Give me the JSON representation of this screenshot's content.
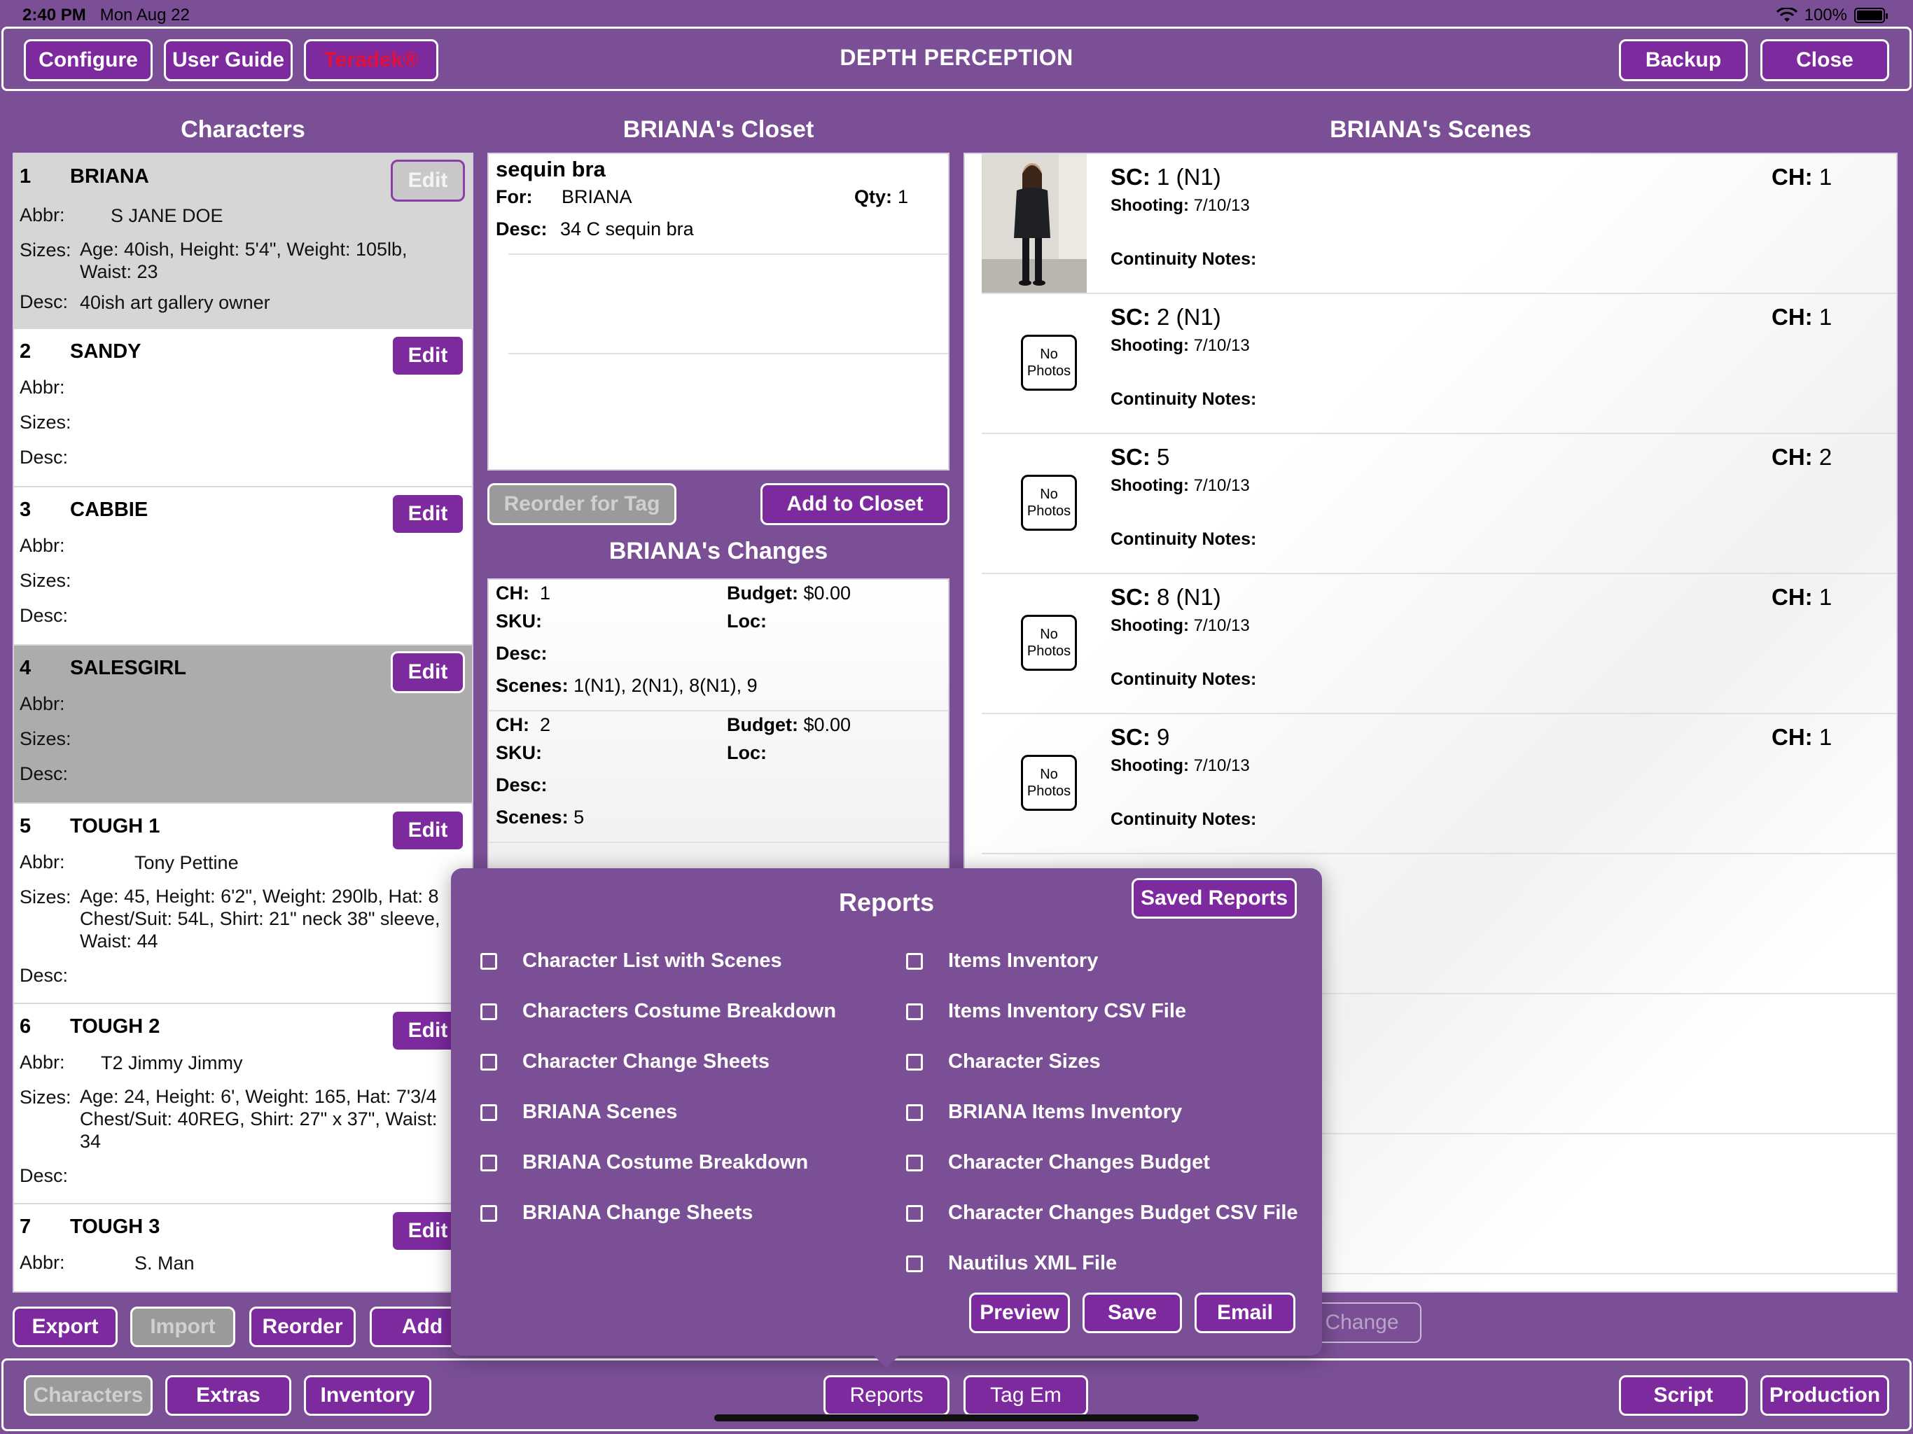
{
  "status": {
    "time": "2:40 PM",
    "date": "Mon Aug 22",
    "battery": "100%"
  },
  "header": {
    "title": "DEPTH PERCEPTION",
    "configure": "Configure",
    "user_guide": "User Guide",
    "teradek": "Teradek®",
    "backup": "Backup",
    "close": "Close"
  },
  "characters": {
    "title": "Characters",
    "edit_label": "Edit",
    "labels": {
      "abbr": "Abbr:",
      "sizes": "Sizes:",
      "desc": "Desc:"
    },
    "items": [
      {
        "num": "1",
        "name": "BRIANA",
        "abbr": "S  JANE DOE",
        "sizes": "Age: 40ish, Height: 5'4\", Weight: 105lb,\nWaist: 23",
        "desc": "40ish art gallery owner"
      },
      {
        "num": "2",
        "name": "SANDY",
        "abbr": "",
        "sizes": "",
        "desc": ""
      },
      {
        "num": "3",
        "name": "CABBIE",
        "abbr": "",
        "sizes": "",
        "desc": ""
      },
      {
        "num": "4",
        "name": "SALESGIRL",
        "abbr": "",
        "sizes": "",
        "desc": ""
      },
      {
        "num": "5",
        "name": "TOUGH 1",
        "abbr": "Tony Pettine",
        "sizes": "Age: 45, Height: 6'2\", Weight: 290lb, Hat: 8\nChest/Suit: 54L, Shirt: 21\" neck 38\" sleeve,\nWaist: 44",
        "desc": ""
      },
      {
        "num": "6",
        "name": "TOUGH 2",
        "abbr": "T2  Jimmy Jimmy",
        "sizes": "Age: 24, Height: 6', Weight: 165, Hat: 7'3/4\nChest/Suit: 40REG, Shirt: 27\" x 37\", Waist:\n34",
        "desc": ""
      },
      {
        "num": "7",
        "name": "TOUGH 3",
        "abbr": "S. Man",
        "sizes": "",
        "desc": ""
      }
    ],
    "export": "Export",
    "import": "Import",
    "reorder": "Reorder",
    "add": "Add"
  },
  "closet": {
    "title": "BRIANA's Closet",
    "item_name": "sequin bra",
    "for_label": "For:",
    "for_value": "BRIANA",
    "qty_label": "Qty:",
    "qty_value": "1",
    "desc_label": "Desc:",
    "desc_value": "34 C sequin bra",
    "reorder_for_tag": "Reorder for Tag",
    "add_to_closet": "Add to Closet"
  },
  "changes": {
    "title": "BRIANA's Changes",
    "labels": {
      "ch": "CH:",
      "budget": "Budget:",
      "sku": "SKU:",
      "loc": "Loc:",
      "desc": "Desc:",
      "scenes": "Scenes:"
    },
    "items": [
      {
        "ch": "1",
        "budget": "$0.00",
        "scenes": "1(N1), 2(N1), 8(N1), 9"
      },
      {
        "ch": "2",
        "budget": "$0.00",
        "scenes": "5"
      }
    ],
    "change_btn": "Change"
  },
  "scenes": {
    "title": "BRIANA's Scenes",
    "labels": {
      "sc": "SC:",
      "ch": "CH:",
      "shooting": "Shooting:",
      "continuity": "Continuity Notes:"
    },
    "no_photos_line1": "No",
    "no_photos_line2": "Photos",
    "items": [
      {
        "sc": "1 (N1)",
        "ch": "1",
        "shooting": "7/10/13",
        "has_photo": true
      },
      {
        "sc": "2 (N1)",
        "ch": "1",
        "shooting": "7/10/13",
        "has_photo": false
      },
      {
        "sc": "5",
        "ch": "2",
        "shooting": "7/10/13",
        "has_photo": false
      },
      {
        "sc": "8 (N1)",
        "ch": "1",
        "shooting": "7/10/13",
        "has_photo": false
      },
      {
        "sc": "9",
        "ch": "1",
        "shooting": "7/10/13",
        "has_photo": false
      }
    ]
  },
  "reports": {
    "title": "Reports",
    "saved_reports": "Saved Reports",
    "left": [
      "Character List with Scenes",
      "Characters Costume Breakdown",
      "Character Change Sheets",
      "BRIANA Scenes",
      "BRIANA Costume Breakdown",
      "BRIANA Change Sheets"
    ],
    "right": [
      "Items Inventory",
      "Items Inventory CSV File",
      "Character Sizes",
      "BRIANA Items Inventory",
      "Character Changes Budget",
      "Character Changes Budget CSV File",
      "Nautilus XML File"
    ],
    "preview": "Preview",
    "save": "Save",
    "email": "Email"
  },
  "tabs": {
    "characters": "Characters",
    "extras": "Extras",
    "inventory": "Inventory",
    "reports": "Reports",
    "tag_em": "Tag Em",
    "script": "Script",
    "production": "Production"
  },
  "colors": {
    "background": "#7a4f96",
    "button": "#7c2a9e",
    "alert_red": "#e0113a"
  }
}
